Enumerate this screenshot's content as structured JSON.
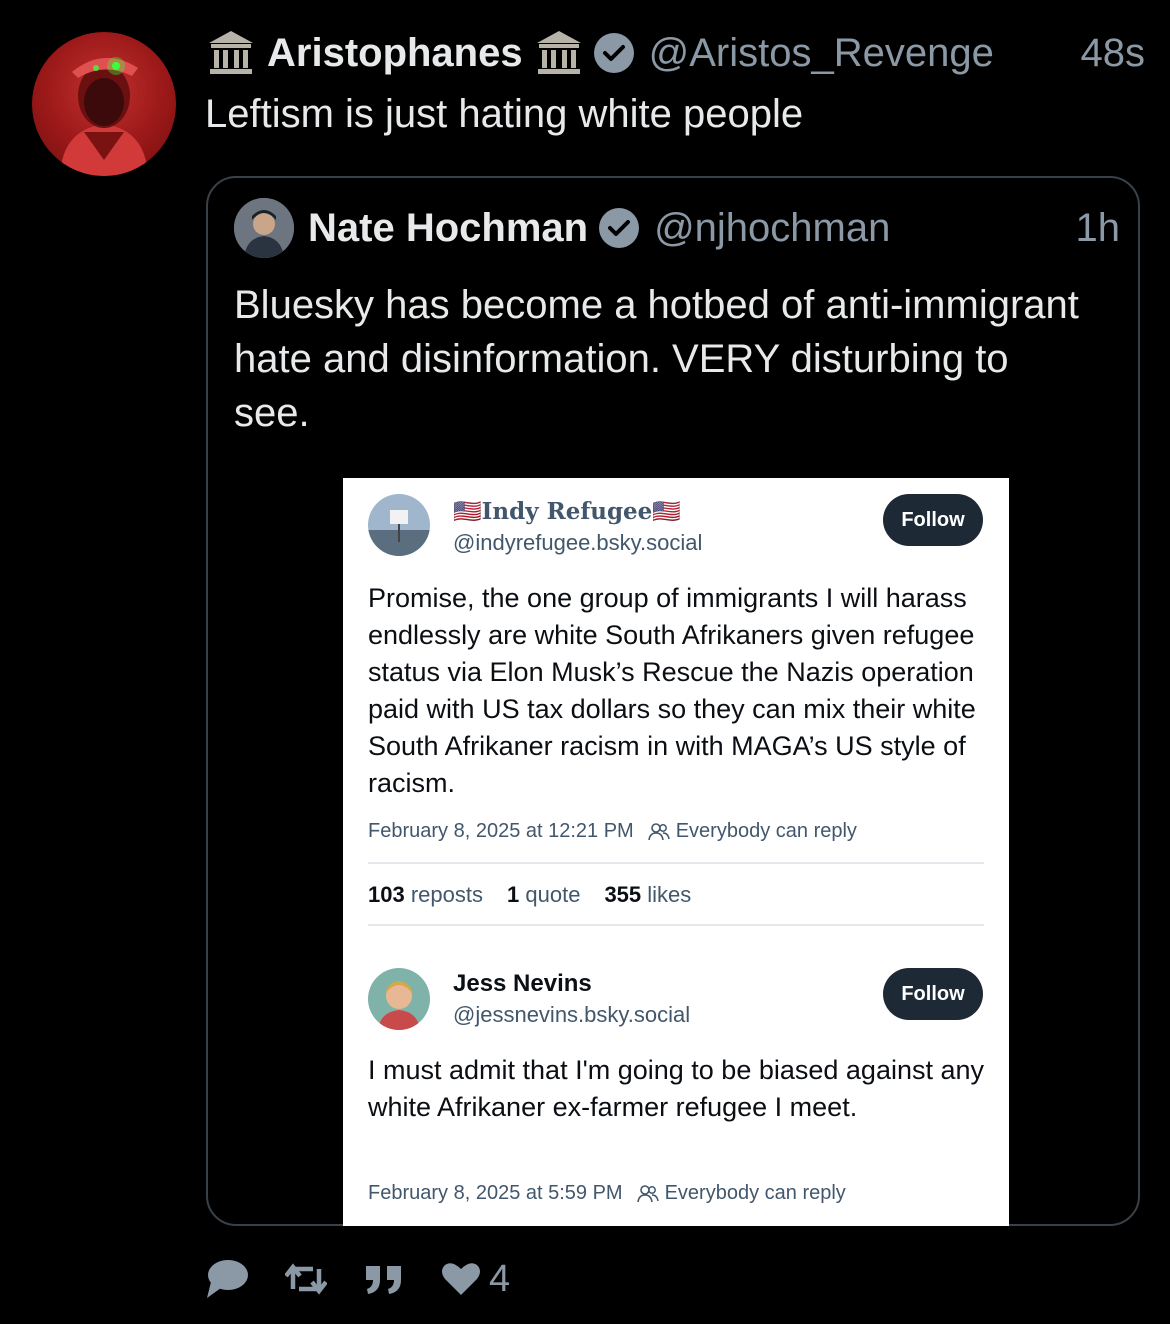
{
  "tweet": {
    "display_name": "Aristophanes",
    "handle": "@Aristos_Revenge",
    "time": "48s",
    "text": "Leftism is just hating white people",
    "avatar_icon": "red-portrait-avatar"
  },
  "quote": {
    "display_name": "Nate Hochman",
    "handle": "@njhochman",
    "time": "1h",
    "text": "Bluesky has become a hotbed of anti-immigrant hate and disinformation. VERY disturbing to see."
  },
  "embed": {
    "post1": {
      "name": "Indy Refugee",
      "handle": "@indyrefugee.bsky.social",
      "follow_label": "Follow",
      "text": "Promise, the one group of immigrants I will harass endlessly are white South Afrikaners given refugee status via Elon Musk’s Rescue the Nazis operation paid with US tax dollars so they can mix their white South Afrikaner racism in with MAGA’s US style of racism.",
      "date": "February 8, 2025 at 12:21 PM",
      "reply_setting": "Everybody can reply",
      "reposts_count": "103",
      "reposts_label": "reposts",
      "quotes_count": "1",
      "quotes_label": "quote",
      "likes_count": "355",
      "likes_label": "likes"
    },
    "post2": {
      "name": "Jess Nevins",
      "handle": "@jessnevins.bsky.social",
      "follow_label": "Follow",
      "text": "I must admit that I'm going to be biased against any white Afrikaner ex-farmer refugee I meet.",
      "date": "February 8, 2025 at 5:59 PM",
      "reply_setting": "Everybody can reply"
    }
  },
  "actions": {
    "like_count": "4"
  },
  "colors": {
    "background": "#000000",
    "text_primary": "#e7e9ea",
    "text_secondary": "#8b98a5",
    "verified_badge": "#8b98a5",
    "card_border": "#3a4048",
    "follow_button": "#1e2936"
  }
}
